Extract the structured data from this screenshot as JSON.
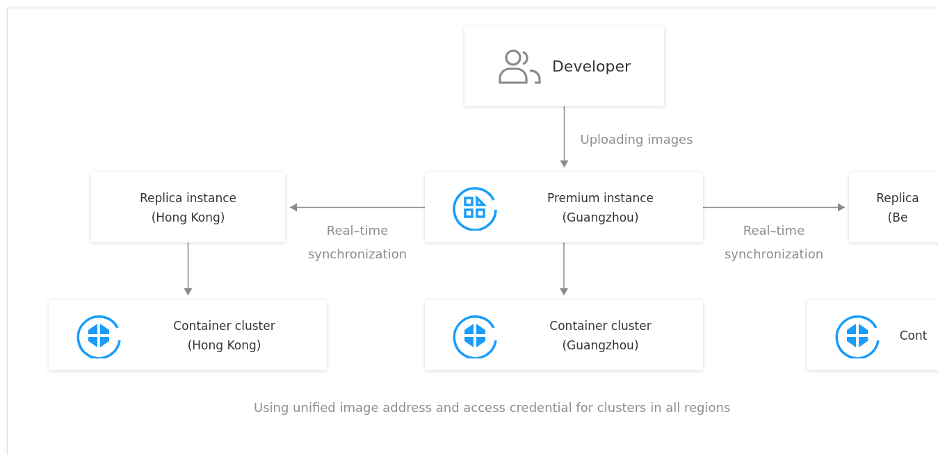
{
  "nodes": [
    {
      "kind": "person",
      "lines": [
        "Developer"
      ]
    },
    {
      "kind": "replica",
      "lines": [
        "Replica instance",
        "(Hong Kong)"
      ]
    },
    {
      "kind": "instance",
      "lines": [
        "Premium instance",
        "(Guangzhou)"
      ]
    },
    {
      "kind": "replica",
      "lines": [
        "Replica",
        "(Be"
      ]
    },
    {
      "kind": "cluster",
      "lines": [
        "Container cluster",
        "(Hong Kong)"
      ]
    },
    {
      "kind": "cluster",
      "lines": [
        "Container cluster",
        "(Guangzhou)"
      ]
    },
    {
      "kind": "cluster",
      "lines": [
        "Cont"
      ]
    }
  ],
  "arrow_labels": [
    "Uploading images",
    "Real–time synchronization",
    "Real–time synchronization"
  ],
  "caption": "Using unified image address and access credential for clusters in all regions"
}
